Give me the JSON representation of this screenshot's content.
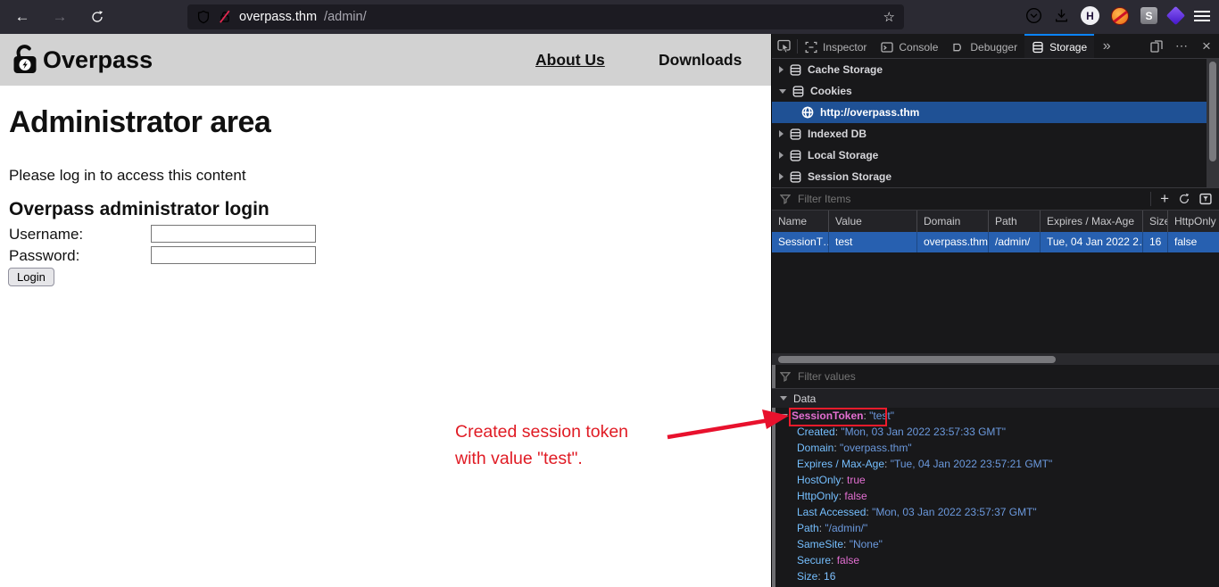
{
  "browser": {
    "url_host": "overpass.thm",
    "url_path": "/admin/",
    "extension_h": "H",
    "extension_s": "S"
  },
  "site": {
    "brand": "Overpass",
    "nav_about": "About Us",
    "nav_downloads": "Downloads",
    "heading": "Administrator area",
    "message": "Please log in to access this content",
    "login_title": "Overpass administrator login",
    "username_label": "Username:",
    "password_label": "Password:",
    "login_button": "Login"
  },
  "devtools": {
    "tabs": {
      "inspector": "Inspector",
      "console": "Console",
      "debugger": "Debugger",
      "storage": "Storage"
    },
    "tree": [
      {
        "label": "Cache Storage"
      },
      {
        "label": "Cookies"
      },
      {
        "label": "http://overpass.thm"
      },
      {
        "label": "Indexed DB"
      },
      {
        "label": "Local Storage"
      },
      {
        "label": "Session Storage"
      }
    ],
    "filter_items": "Filter Items",
    "filter_values": "Filter values",
    "columns": [
      "Name",
      "Value",
      "Domain",
      "Path",
      "Expires / Max-Age",
      "Size",
      "HttpOnly"
    ],
    "row": [
      "SessionT…",
      "test",
      "overpass.thm",
      "/admin/",
      "Tue, 04 Jan 2022 2…",
      "16",
      "false"
    ],
    "data_section": "Data",
    "cookie": {
      "name": "SessionToken",
      "value": "\"test\"",
      "props": [
        {
          "key": "Created",
          "value": "\"Mon, 03 Jan 2022 23:57:33 GMT\""
        },
        {
          "key": "Domain",
          "value": "\"overpass.thm\""
        },
        {
          "key": "Expires / Max-Age",
          "value": "\"Tue, 04 Jan 2022 23:57:21 GMT\""
        },
        {
          "key": "HostOnly",
          "value": "true"
        },
        {
          "key": "HttpOnly",
          "value": "false"
        },
        {
          "key": "Last Accessed",
          "value": "\"Mon, 03 Jan 2022 23:57:37 GMT\""
        },
        {
          "key": "Path",
          "value": "\"/admin/\""
        },
        {
          "key": "SameSite",
          "value": "\"None\""
        },
        {
          "key": "Secure",
          "value": "false"
        },
        {
          "key": "Size",
          "value": "16"
        }
      ]
    }
  },
  "annotation": {
    "line1": "Created session token",
    "line2": "with value \"test\"."
  },
  "glyphs": {
    "sep": ": ",
    "back": "←",
    "forward": "→",
    "more_tabs": "»",
    "menu_dots": "⋯",
    "close": "×",
    "add": "+",
    "star": "☆"
  },
  "colors": {
    "accent_blue": "#0a84ff",
    "tree_selection": "#1f5195",
    "row_selection": "#2760b0",
    "annotation_red": "#e01b24",
    "key_blue": "#75bfff",
    "string_blue": "#6b99dd",
    "bool_pink": "#e36fd2"
  }
}
